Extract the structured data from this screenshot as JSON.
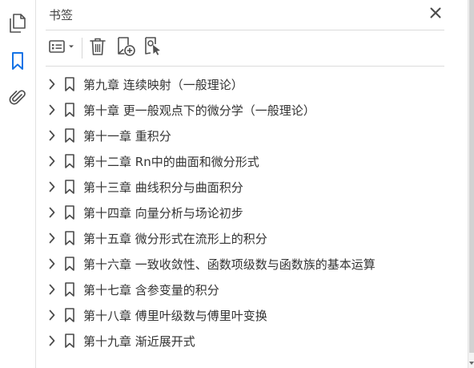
{
  "panel": {
    "title": "书签"
  },
  "rail": {
    "items": [
      {
        "icon": "pages-icon"
      },
      {
        "icon": "bookmark-icon",
        "active": true
      },
      {
        "icon": "attachment-icon"
      }
    ],
    "active_color": "#1473e6"
  },
  "toolbar": {
    "buttons": [
      {
        "icon": "options-menu-icon"
      },
      {
        "icon": "trash-icon"
      },
      {
        "icon": "new-bookmark-icon"
      },
      {
        "icon": "new-bookmark-from-selection-icon"
      }
    ]
  },
  "bookmarks": [
    {
      "label": "第九章  连续映射（一般理论）"
    },
    {
      "label": "第十章  更一般观点下的微分学（一般理论）"
    },
    {
      "label": "第十一章  重积分"
    },
    {
      "label": "第十二章  Rn中的曲面和微分形式"
    },
    {
      "label": "第十三章  曲线积分与曲面积分"
    },
    {
      "label": "第十四章  向量分析与场论初步"
    },
    {
      "label": "第十五章  微分形式在流形上的积分"
    },
    {
      "label": "第十六章  一致收敛性、函数项级数与函数族的基本运算"
    },
    {
      "label": "第十七章  含参变量的积分"
    },
    {
      "label": "第十八章  傅里叶级数与傅里叶变换"
    },
    {
      "label": "第十九章  渐近展开式"
    }
  ]
}
